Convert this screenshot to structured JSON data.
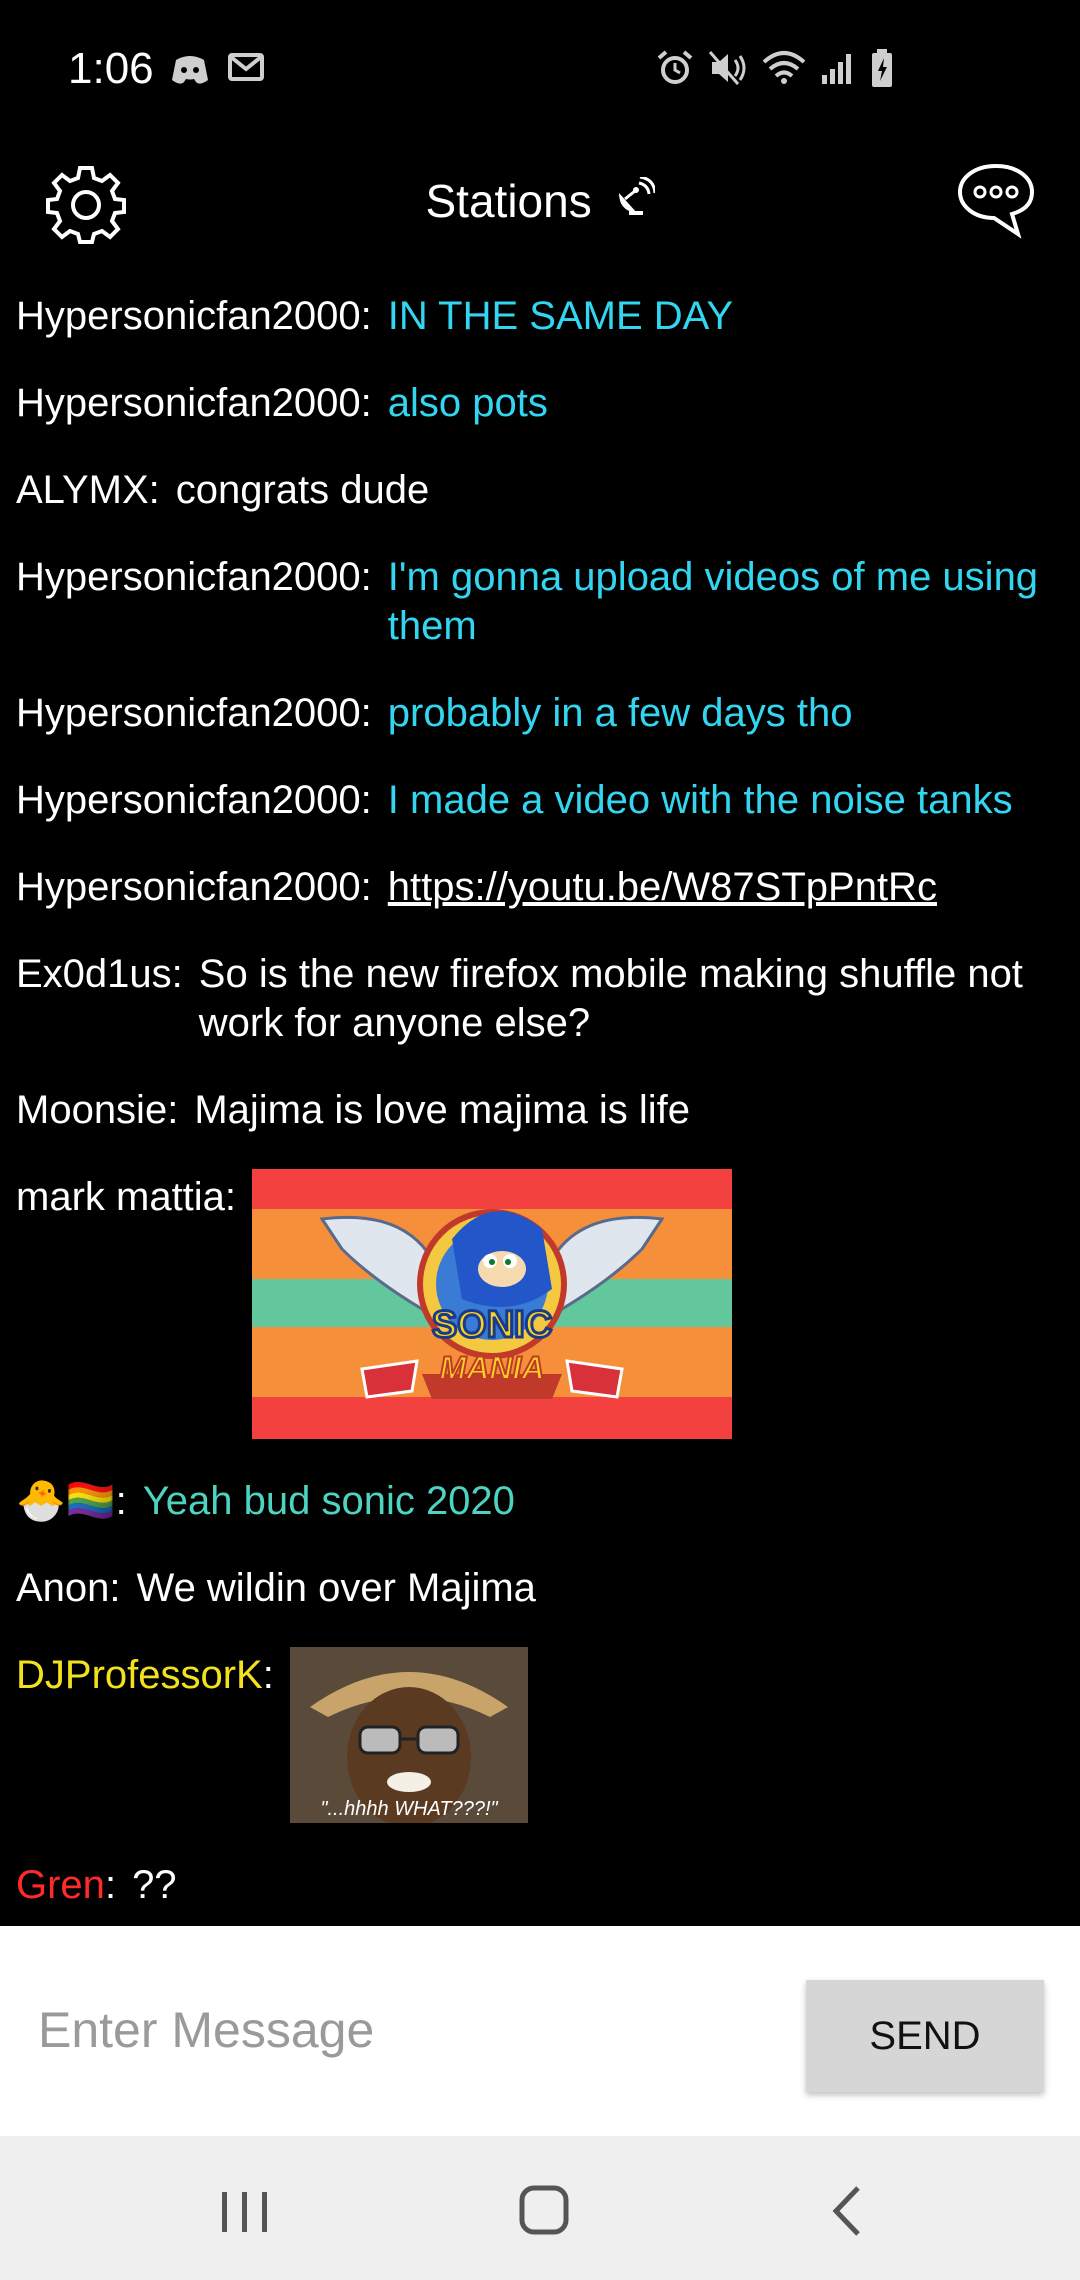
{
  "status_bar": {
    "time": "1:06",
    "left_icons": [
      "discord-icon",
      "gmail-icon"
    ],
    "right_icons": [
      "alarm-icon",
      "mute-icon",
      "wifi-icon",
      "signal-icon",
      "battery-icon"
    ]
  },
  "header": {
    "title": "Stations",
    "settings_icon": "gear-icon",
    "title_icon": "satellite-dish-icon",
    "chat_icon": "chat-bubble-icon"
  },
  "messages": [
    {
      "user": "Hypersonicfan2000:",
      "text": "IN THE SAME DAY"
    },
    {
      "user": "Hypersonicfan2000:",
      "text": "also pots"
    },
    {
      "user": "ALYMX:",
      "text": "congrats dude"
    },
    {
      "user": "Hypersonicfan2000:",
      "text": "I'm gonna upload videos of me using them"
    },
    {
      "user": "Hypersonicfan2000:",
      "text": "probably in a few days tho"
    },
    {
      "user": "Hypersonicfan2000:",
      "text": "I made a video with the noise tanks"
    },
    {
      "user": "Hypersonicfan2000:",
      "text": "https://youtu.be/W87STpPntRc"
    },
    {
      "user": "Ex0d1us:",
      "text": "So is the new firefox mobile making shuffle not work for anyone else?"
    },
    {
      "user": "Moonsie:",
      "text": "Majima is love majima is life"
    },
    {
      "user": "mark mattia:",
      "image": "sonic-mania-logo",
      "logo_text_1": "SONIC",
      "logo_text_2": "MANIA"
    },
    {
      "user": "🐣🏳️‍🌈",
      "separator": ":",
      "text": "Yeah bud sonic 2020"
    },
    {
      "user": "Anon:",
      "text": "We wildin over Majima"
    },
    {
      "user": "DJProfessorK",
      "separator": ":",
      "image": "what-reaction-gif",
      "caption": "\"...hhhh WHAT???!\""
    },
    {
      "user": "Gren",
      "separator": ":",
      "text": "??"
    }
  ],
  "composer": {
    "placeholder": "Enter Message",
    "send_label": "SEND"
  },
  "nav_bar": [
    "recents-icon",
    "home-icon",
    "back-icon"
  ],
  "colors": {
    "cyan_message": "#33d6f0",
    "teal_message": "#4fd3c1",
    "yellow_user": "#f2e21e",
    "red_user": "#ff2a2a",
    "send_button": "#d6d6d6"
  }
}
